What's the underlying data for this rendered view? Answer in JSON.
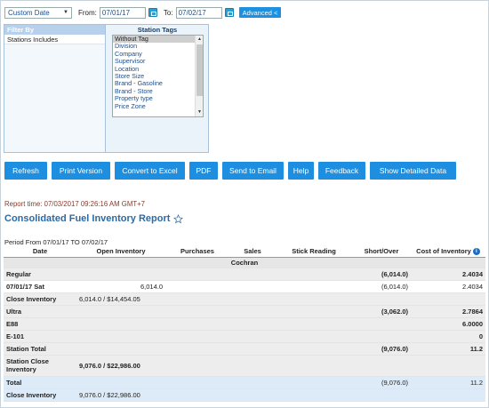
{
  "filters": {
    "range_select": "Custom Date",
    "from_label": "From:",
    "from_value": "07/01/17",
    "to_label": "To:",
    "to_value": "07/02/17",
    "advanced_label": "Advanced <"
  },
  "filter_panel": {
    "filter_by_header": "Filter By",
    "filter_by_item": "Stations Includes",
    "station_tags_header": "Station Tags",
    "station_tags": [
      "Without Tag",
      "Division",
      "Company",
      "Supervisor",
      "Location",
      "Store Size",
      "Brand - Gasoline",
      "Brand - Store",
      "Property type",
      "Price Zone"
    ]
  },
  "actions": [
    {
      "label": "Refresh"
    },
    {
      "label": "Print Version"
    },
    {
      "label": "Convert to Excel"
    },
    {
      "label": "PDF"
    },
    {
      "label": "Send to Email"
    },
    {
      "label": "Help"
    },
    {
      "label": "Feedback"
    },
    {
      "label": "Show Detailed Data"
    }
  ],
  "report": {
    "time": "Report time: 07/03/2017 09:26:16 AM GMT+7",
    "title": "Consolidated Fuel Inventory Report",
    "period": "Period From 07/01/17 TO 07/02/17"
  },
  "table": {
    "headers": [
      "Date",
      "Open Inventory",
      "Purchases",
      "Sales",
      "Stick Reading",
      "Short/Over",
      "Cost of Inventory"
    ],
    "group": "Cochran",
    "rows": [
      {
        "date": "Regular",
        "open": "",
        "short": "(6,014.0)",
        "cost": "2.4034"
      },
      {
        "date": "07/01/17 Sat",
        "open": "6,014.0",
        "short": "(6,014.0)",
        "cost": "2.4034"
      },
      {
        "date": "Close Inventory",
        "open": "6,014.0 / $14,454.05",
        "short": "",
        "cost": ""
      },
      {
        "date": "Ultra",
        "open": "",
        "short": "(3,062.0)",
        "cost": "2.7864"
      },
      {
        "date": "E88",
        "open": "",
        "short": "",
        "cost": "6.0000"
      },
      {
        "date": "E-101",
        "open": "",
        "short": "",
        "cost": "0"
      },
      {
        "date": "Station Total",
        "open": "",
        "short": "(9,076.0)",
        "cost": "11.2"
      },
      {
        "date": "Station Close Inventory",
        "open": "9,076.0 / $22,986.00",
        "short": "",
        "cost": ""
      },
      {
        "date": "Total",
        "open": "",
        "short": "(9,076.0)",
        "cost": "11.2"
      },
      {
        "date": "Close Inventory",
        "open": "9,076.0 / $22,986.00",
        "short": "",
        "cost": ""
      }
    ]
  }
}
